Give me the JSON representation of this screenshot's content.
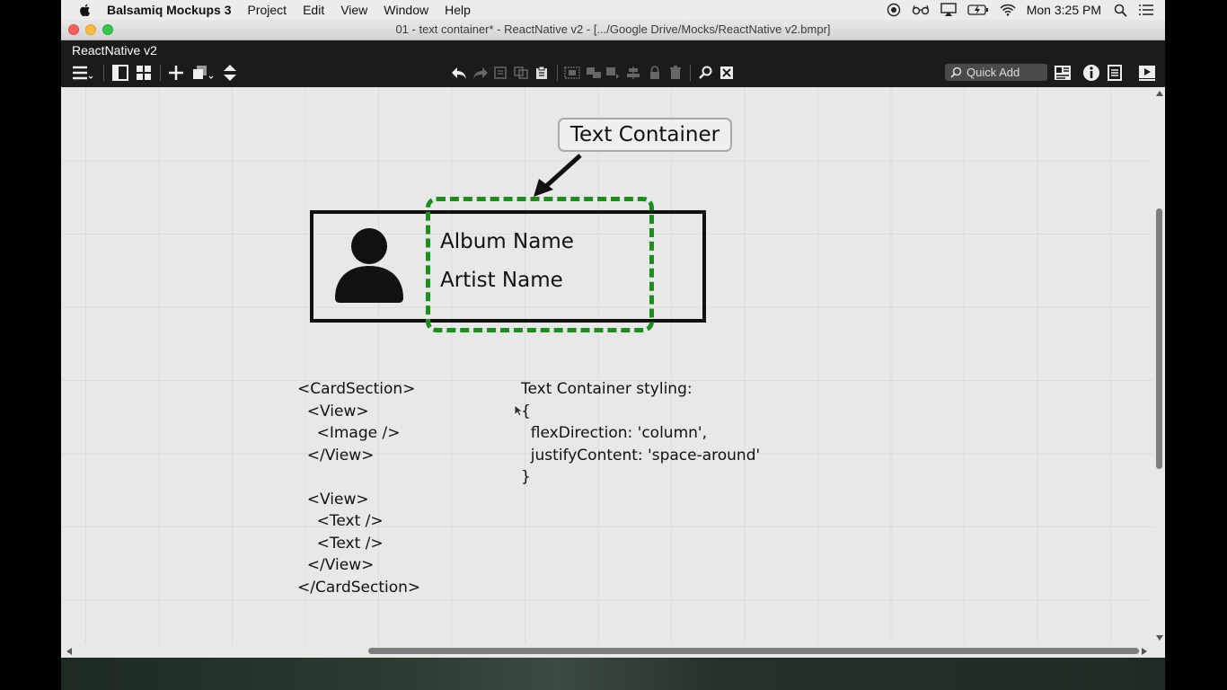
{
  "menubar": {
    "app_name": "Balsamiq Mockups 3",
    "items": [
      "Project",
      "Edit",
      "View",
      "Window",
      "Help"
    ],
    "clock": "Mon 3:25 PM"
  },
  "window": {
    "title": "01 - text container* - ReactNative v2 - [.../Google Drive/Mocks/ReactNative v2.bmpr]"
  },
  "app": {
    "project_name": "ReactNative v2",
    "quick_add_placeholder": "Quick Add"
  },
  "mockup": {
    "callout_label": "Text Container",
    "album_name": "Album Name",
    "artist_name": "Artist Name",
    "container_color": "#1b8f1b",
    "code_left": [
      "<CardSection>",
      "  <View>",
      "    <Image />",
      "  </View>",
      "",
      "  <View>",
      "    <Text />",
      "    <Text />",
      "  </View>",
      "</CardSection>"
    ],
    "code_right": [
      "Text Container styling:",
      "{",
      "  flexDirection: 'column',",
      "  justifyContent: 'space-around'",
      "}"
    ]
  }
}
